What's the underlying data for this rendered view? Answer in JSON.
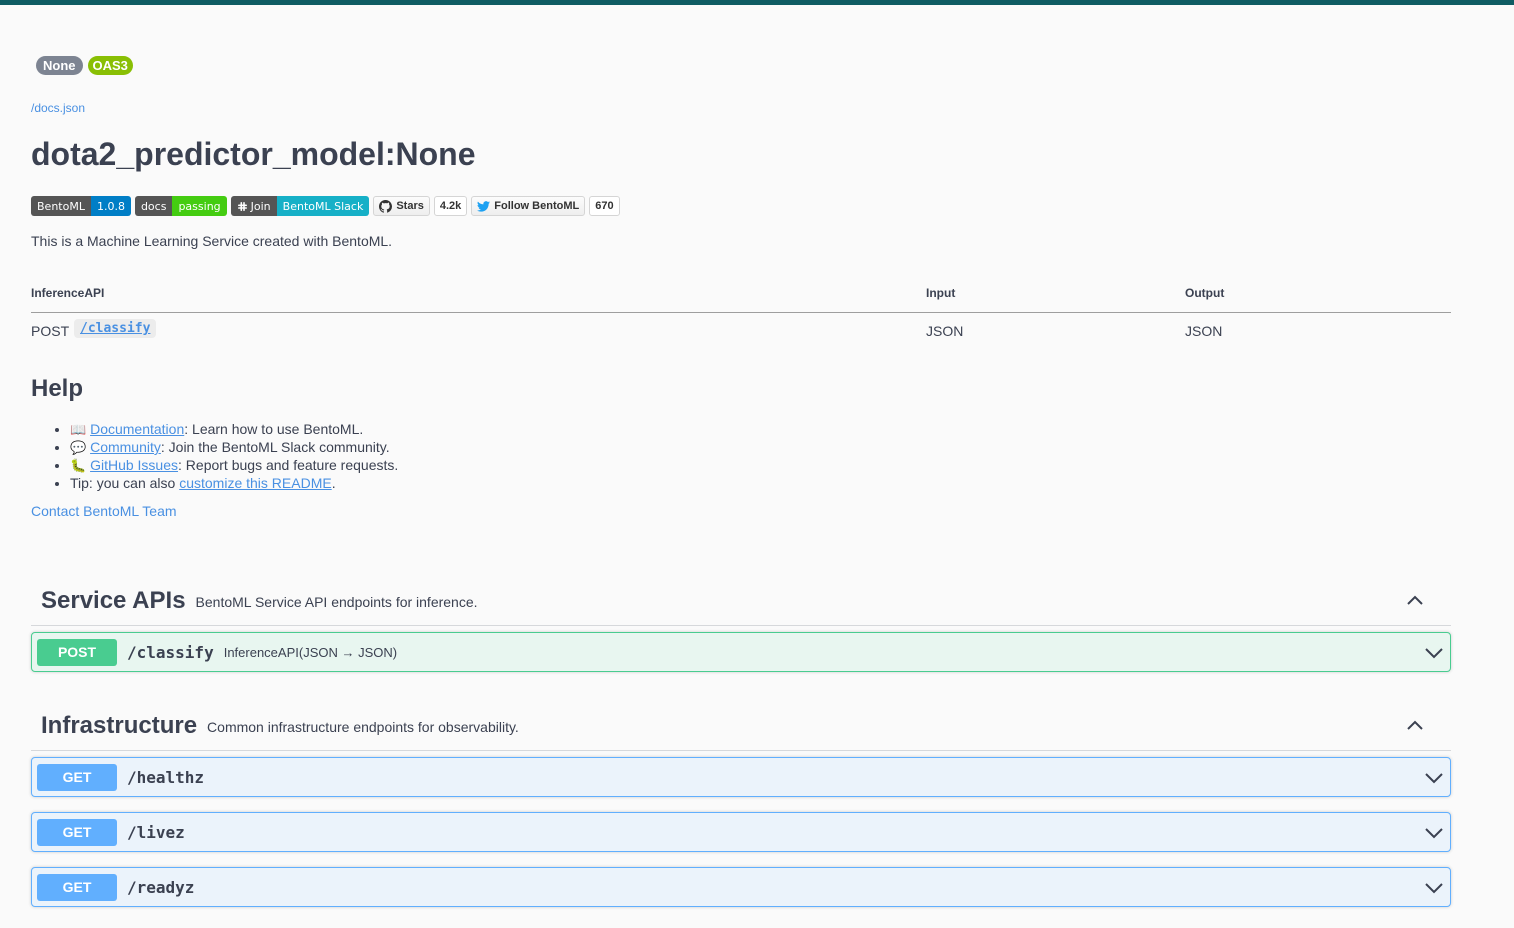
{
  "info": {
    "version_pill": "None",
    "oas_pill": "OAS3",
    "docs_link": "/docs.json",
    "title": "dota2_predictor_model:None",
    "description": "This is a Machine Learning Service created with BentoML."
  },
  "badges": {
    "bentoml": {
      "label": "BentoML",
      "value": "1.0.8"
    },
    "docs": {
      "label": "docs",
      "value": "passing"
    },
    "slack": {
      "label": "Join",
      "value": "BentoML Slack"
    },
    "github": {
      "label": "Stars",
      "count": "4.2k"
    },
    "twitter": {
      "label": "Follow BentoML",
      "count": "670"
    }
  },
  "api_table": {
    "headers": [
      "InferenceAPI",
      "Input",
      "Output"
    ],
    "rows": [
      {
        "method": "POST",
        "path": "/classify",
        "input": "JSON",
        "output": "JSON"
      }
    ]
  },
  "help": {
    "heading": "Help",
    "items": [
      {
        "emoji": "📖",
        "link": "Documentation",
        "text": ": Learn how to use BentoML."
      },
      {
        "emoji": "💬",
        "link": "Community",
        "text": ": Join the BentoML Slack community."
      },
      {
        "emoji": "🐛",
        "link": "GitHub Issues",
        "text": ": Report bugs and feature requests."
      },
      {
        "prefix": "Tip: you can also ",
        "link": "customize this README",
        "text": "."
      }
    ],
    "contact": "Contact BentoML Team"
  },
  "sections": [
    {
      "name": "Service APIs",
      "description": "BentoML Service API endpoints for inference.",
      "operations": [
        {
          "method": "POST",
          "path": "/classify",
          "summary": "InferenceAPI(JSON → JSON)"
        }
      ]
    },
    {
      "name": "Infrastructure",
      "description": "Common infrastructure endpoints for observability.",
      "operations": [
        {
          "method": "GET",
          "path": "/healthz",
          "summary": ""
        },
        {
          "method": "GET",
          "path": "/livez",
          "summary": ""
        },
        {
          "method": "GET",
          "path": "/readyz",
          "summary": ""
        }
      ]
    }
  ],
  "colors": {
    "topbar": "#0f5c63",
    "post": "#49cc90",
    "get": "#61affe",
    "link": "#4990e2"
  }
}
